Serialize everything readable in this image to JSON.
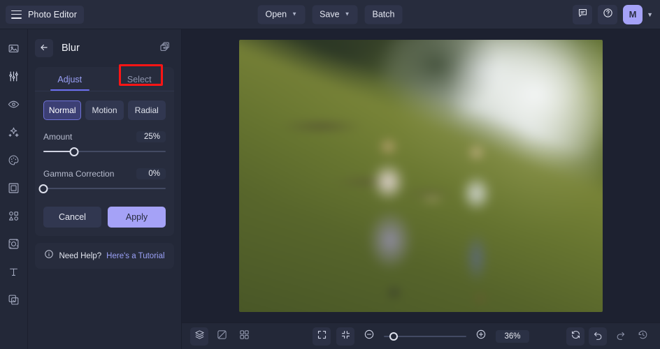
{
  "app": {
    "brand_label": "Photo Editor",
    "menu_icon": "hamburger-icon",
    "accent": "#a5a2f7",
    "link_color": "#9aa0f6",
    "highlight_color": "#ff1515",
    "panel_bg": "#232838",
    "canvas_bg": "#1d2130"
  },
  "topbar": {
    "open_label": "Open",
    "save_label": "Save",
    "batch_label": "Batch",
    "caret": "⌄",
    "feedback_icon": "chat-bubble-icon",
    "help_icon": "question-circle-icon",
    "avatar_initial": "M",
    "avatar_caret": "⌄"
  },
  "rail": {
    "items": [
      {
        "name": "image-icon",
        "title": "Image"
      },
      {
        "name": "adjust-sliders-icon",
        "title": "Adjust"
      },
      {
        "name": "eye-icon",
        "title": "Retouch"
      },
      {
        "name": "sparkles-icon",
        "title": "Effects"
      },
      {
        "name": "palette-icon",
        "title": "Color"
      },
      {
        "name": "frame-icon",
        "title": "Frames"
      },
      {
        "name": "shapes-icon",
        "title": "Shapes"
      },
      {
        "name": "crop-transform-icon",
        "title": "Transform"
      },
      {
        "name": "text-icon",
        "title": "Text"
      },
      {
        "name": "layers-overlay-icon",
        "title": "Overlay"
      }
    ]
  },
  "panel": {
    "back_icon": "arrow-left-icon",
    "title": "Blur",
    "duplicate_icon": "add-to-batch-icon",
    "tabs": [
      {
        "label": "Adjust",
        "active": true
      },
      {
        "label": "Select",
        "active": false
      }
    ],
    "modes": [
      {
        "label": "Normal",
        "active": true
      },
      {
        "label": "Motion",
        "active": false
      },
      {
        "label": "Radial",
        "active": false
      }
    ],
    "sliders": [
      {
        "label": "Amount",
        "value": "25%",
        "percent": 25
      },
      {
        "label": "Gamma Correction",
        "value": "0%",
        "percent": 0
      }
    ],
    "cancel_label": "Cancel",
    "apply_label": "Apply",
    "help": {
      "icon": "info-circle-icon",
      "text": "Need Help?",
      "link": "Here's a Tutorial"
    }
  },
  "bottombar": {
    "left_icons": [
      {
        "name": "layers-icon",
        "filled": true
      },
      {
        "name": "compare-split-icon",
        "filled": false
      },
      {
        "name": "grid-view-icon",
        "filled": false
      }
    ],
    "center_icons": [
      {
        "name": "fullscreen-icon",
        "filled": true
      },
      {
        "name": "fit-to-screen-icon",
        "filled": true
      }
    ],
    "zoom_out_icon": "zoom-out-icon",
    "zoom_in_icon": "zoom-in-icon",
    "zoom_value": "36%",
    "zoom_percent": 12,
    "right_icons": [
      {
        "name": "reset-rotate-icon",
        "filled": true
      },
      {
        "name": "undo-icon",
        "filled": true
      },
      {
        "name": "redo-icon",
        "filled": false
      },
      {
        "name": "history-icon",
        "filled": false
      }
    ]
  },
  "canvas": {
    "image_description": "Blurred photo of two people holding hands walking up a grassy hillside in front of a waterfall"
  }
}
